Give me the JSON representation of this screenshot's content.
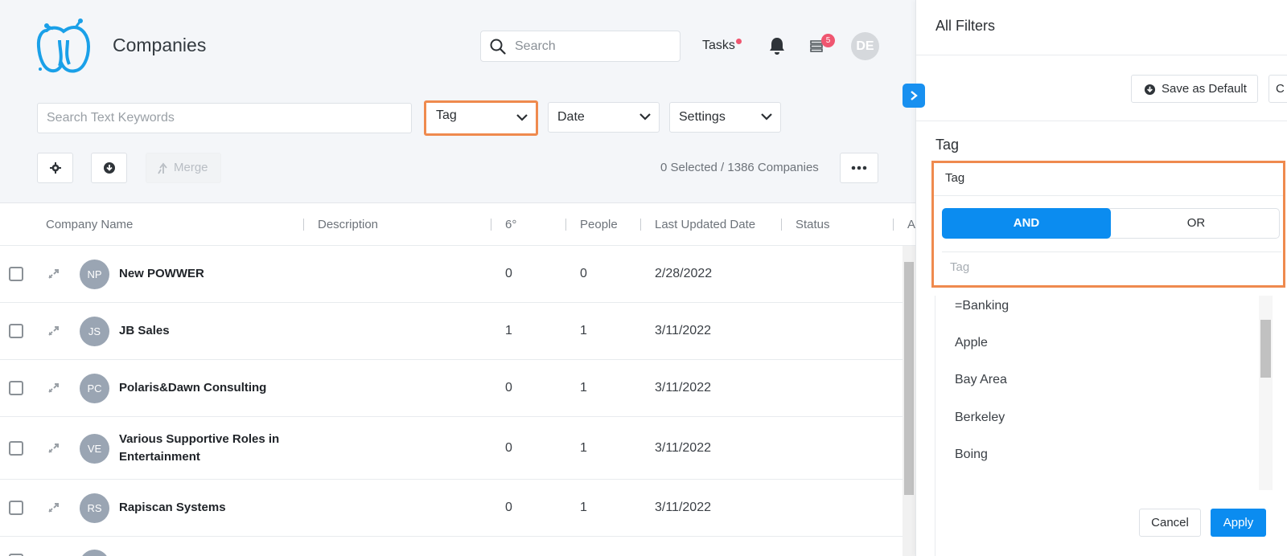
{
  "app": {
    "title": "Companies"
  },
  "header": {
    "search_placeholder": "Search",
    "tasks_label": "Tasks",
    "notification_badge": "5",
    "user_initials": "DE"
  },
  "filters": {
    "keyword_placeholder": "Search Text Keywords",
    "tag_label": "Tag",
    "date_label": "Date",
    "settings_label": "Settings"
  },
  "toolbar": {
    "merge_label": "Merge",
    "selected_count": "0 Selected / 1386 Companies"
  },
  "table": {
    "columns": [
      "Company Name",
      "Description",
      "6°",
      "People",
      "Last Updated Date",
      "Status",
      "A"
    ],
    "rows": [
      {
        "initials": "NP",
        "name": "New POWWER",
        "six": "0",
        "people": "0",
        "date": "2/28/2022"
      },
      {
        "initials": "JS",
        "name": "JB Sales",
        "six": "1",
        "people": "1",
        "date": "3/11/2022"
      },
      {
        "initials": "PC",
        "name": "Polaris&Dawn Consulting",
        "six": "0",
        "people": "1",
        "date": "3/11/2022"
      },
      {
        "initials": "VE",
        "name": "Various Supportive Roles in Entertainment",
        "six": "0",
        "people": "1",
        "date": "3/11/2022"
      },
      {
        "initials": "RS",
        "name": "Rapiscan Systems",
        "six": "0",
        "people": "1",
        "date": "3/11/2022"
      }
    ]
  },
  "panel": {
    "title": "All Filters",
    "save_default_label": "Save as Default",
    "c_label": "C",
    "section_title": "Tag",
    "tag_box_label": "Tag",
    "and_label": "AND",
    "or_label": "OR",
    "tag_input_placeholder": "Tag",
    "tag_options": [
      "=Banking",
      "Apple",
      "Bay Area",
      "Berkeley",
      "Boing"
    ],
    "cancel_label": "Cancel",
    "apply_label": "Apply"
  },
  "colors": {
    "accent": "#0b8cf0",
    "highlight": "#ef8a4e",
    "badge": "#ef5670",
    "avatar": "#9aa5b3"
  }
}
